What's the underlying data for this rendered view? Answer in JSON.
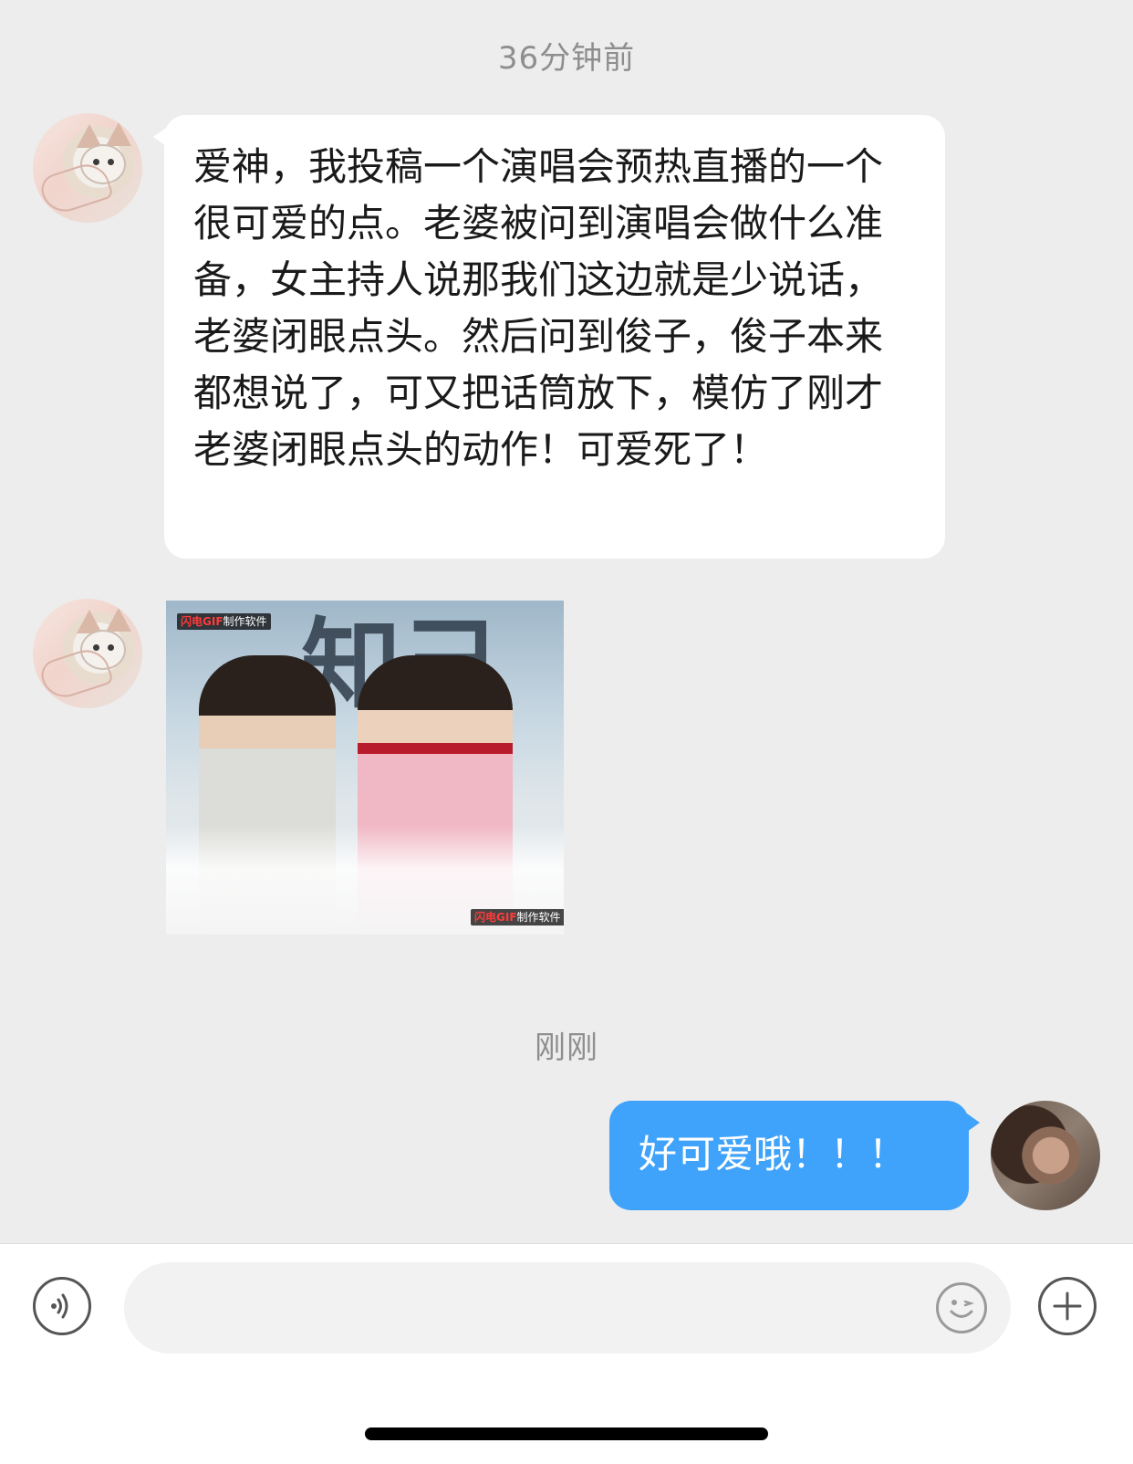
{
  "timestamps": {
    "first": "36分钟前",
    "second": "刚刚"
  },
  "messages": [
    {
      "sender": "other",
      "type": "text",
      "text": "爱神，我投稿一个演唱会预热直播的一个很可爱的点。老婆被问到演唱会做什么准备，女主持人说那我们这边就是少说话，老婆闭眼点头。然后问到俊子，俊子本来都想说了，可又把话筒放下，模仿了刚才老婆闭眼点头的动作！可爱死了！"
    },
    {
      "sender": "other",
      "type": "image",
      "watermark_brand": "闪电GIF",
      "watermark_text": "制作软件",
      "background_text": "知己"
    },
    {
      "sender": "me",
      "type": "text",
      "text": "好可爱哦！！！"
    }
  ],
  "input_bar": {
    "placeholder": "",
    "voice_icon": "voice-icon",
    "emoji_icon": "emoji-icon",
    "add_icon": "plus-icon"
  },
  "colors": {
    "background": "#ededed",
    "incoming_bubble": "#ffffff",
    "outgoing_bubble": "#3fa2fb",
    "timestamp": "#8e8e8e"
  }
}
